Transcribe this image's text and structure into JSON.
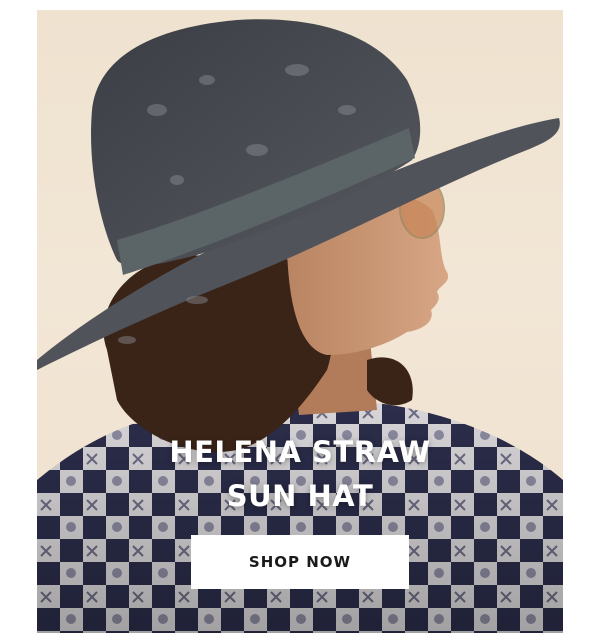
{
  "promo": {
    "headline_line1": "HELENA STRAW",
    "headline_line2": "SUN HAT",
    "cta_label": "SHOP NOW"
  },
  "colors": {
    "background": "#efe2cf",
    "button_bg": "#ffffff",
    "button_text": "#1a1a1a",
    "headline_text": "#ffffff"
  }
}
